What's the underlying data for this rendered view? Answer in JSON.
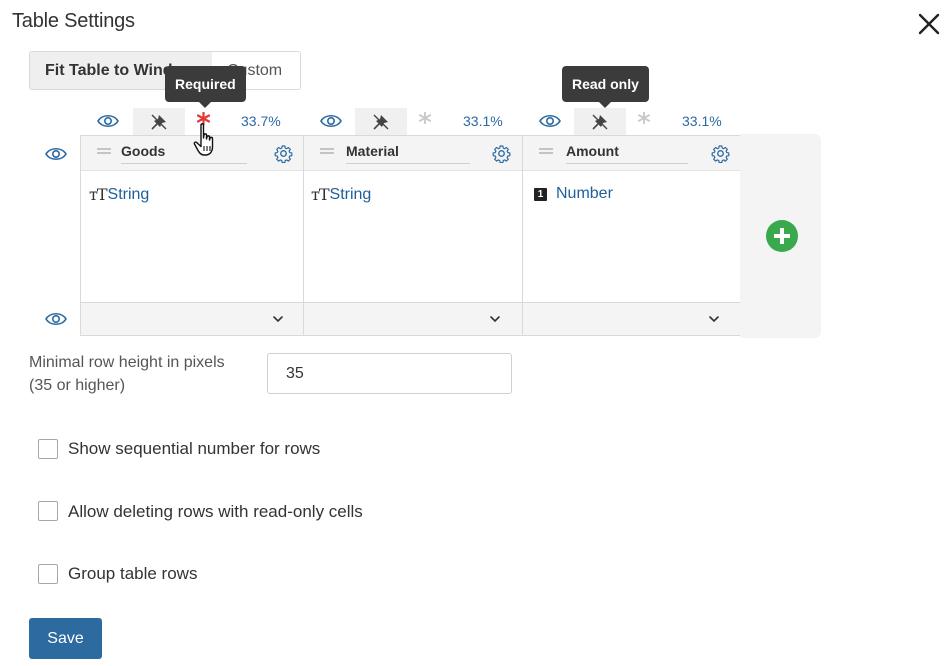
{
  "dialog": {
    "title": "Table Settings"
  },
  "mode_toggle": {
    "fit_label": "Fit Table to Window",
    "custom_label": "Custom",
    "selected": "Fit Table to Window"
  },
  "tooltips": {
    "required": "Required",
    "read_only": "Read only"
  },
  "columns": [
    {
      "name": "Goods",
      "width_pct": "33.7%",
      "type_label": "String",
      "type_icon": "text-type-icon",
      "required": true
    },
    {
      "name": "Material",
      "width_pct": "33.1%",
      "type_label": "String",
      "type_icon": "text-type-icon",
      "required": false
    },
    {
      "name": "Amount",
      "width_pct": "33.1%",
      "type_label": "Number",
      "type_icon": "number-type-icon",
      "type_badge": "1",
      "required": false
    }
  ],
  "settings": {
    "min_row_height_label": "Minimal row height in pixels (35 or higher)",
    "min_row_height_value": "35",
    "show_sequential_label": "Show sequential number for rows",
    "show_sequential_checked": false,
    "allow_deleting_label": "Allow deleting rows with read-only cells",
    "allow_deleting_checked": false,
    "group_rows_label": "Group table rows",
    "group_rows_checked": false
  },
  "actions": {
    "save_label": "Save"
  },
  "colors": {
    "accent": "#2c6aa0",
    "link": "#1f5f99",
    "add_button": "#3aa84c",
    "required_star": "#e53935",
    "tooltip_bg": "#3b3b3b"
  }
}
